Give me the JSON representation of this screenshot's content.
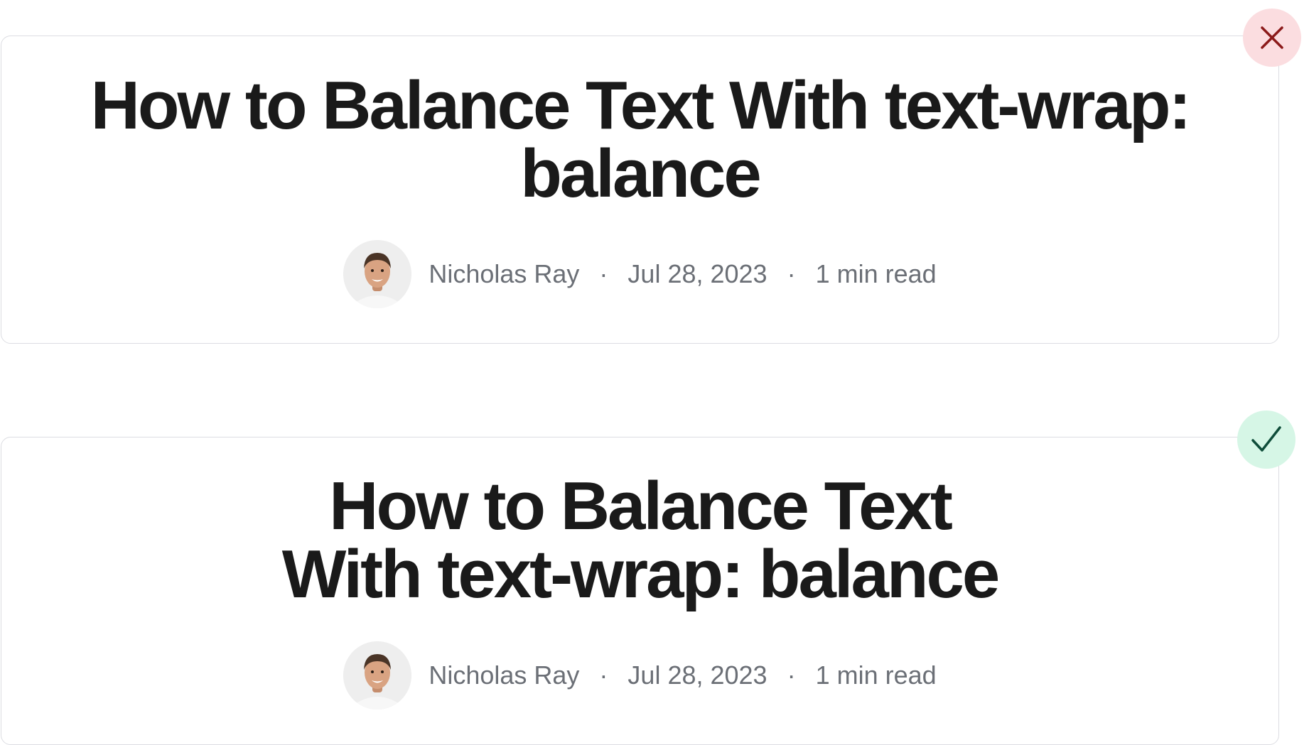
{
  "examples": [
    {
      "status": "incorrect",
      "status_icon": "close-icon",
      "status_color": "#8b1a1a",
      "status_bg": "#fbdde0",
      "title": "How to Balance Text With text-wrap: balance",
      "author": "Nicholas Ray",
      "separator": "·",
      "date": "Jul 28, 2023",
      "read_time": "1 min read"
    },
    {
      "status": "correct",
      "status_icon": "check-icon",
      "status_color": "#0f4d3a",
      "status_bg": "#d6f6e6",
      "title_lines": [
        "How to Balance Text",
        "With text-wrap: balance"
      ],
      "author": "Nicholas Ray",
      "separator": "·",
      "date": "Jul 28, 2023",
      "read_time": "1 min read"
    }
  ]
}
